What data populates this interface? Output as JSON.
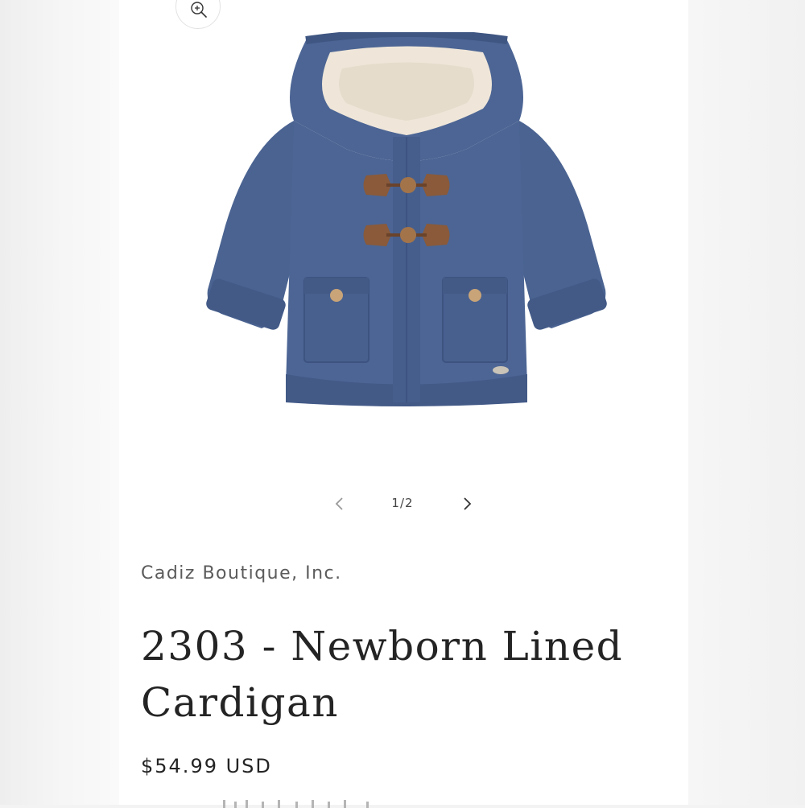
{
  "gallery": {
    "zoom_icon": "zoom-in-icon",
    "image_alt": "2303 - Newborn Lined Cardigan",
    "pager": {
      "count": "1/2",
      "prev_icon": "chevron-left-icon",
      "next_icon": "chevron-right-icon"
    }
  },
  "product": {
    "vendor": "Cadiz Boutique, Inc.",
    "title": "2303 - Newborn Lined Cardigan",
    "price": "$54.99 USD"
  },
  "colors": {
    "cardigan_blue": "#4c6594",
    "toggle_brown": "#8a5a3a",
    "lining_cream": "#efe6d9",
    "text_dark": "#242424"
  }
}
